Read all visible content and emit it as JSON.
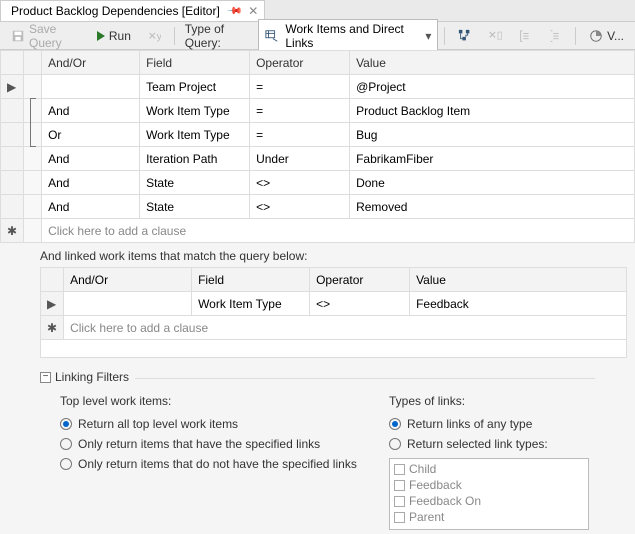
{
  "tab": {
    "title": "Product Backlog Dependencies [Editor]"
  },
  "toolbar": {
    "save_label": "Save Query",
    "run_label": "Run",
    "type_label": "Type of Query:",
    "type_value": "Work Items and Direct Links",
    "view_label": "V..."
  },
  "grid": {
    "headers": {
      "andor": "And/Or",
      "field": "Field",
      "operator": "Operator",
      "value": "Value"
    },
    "rows": [
      {
        "gutter": "▶",
        "group": "",
        "andor": "",
        "field": "Team Project",
        "operator": "=",
        "value": "@Project"
      },
      {
        "gutter": "",
        "group": "[",
        "andor": "And",
        "field": "Work Item Type",
        "operator": "=",
        "value": "Product Backlog Item"
      },
      {
        "gutter": "",
        "group": "]",
        "andor": "Or",
        "field": "Work Item Type",
        "operator": "=",
        "value": "Bug"
      },
      {
        "gutter": "",
        "group": "",
        "andor": "And",
        "field": "Iteration Path",
        "operator": "Under",
        "value": "FabrikamFiber"
      },
      {
        "gutter": "",
        "group": "",
        "andor": "And",
        "field": "State",
        "operator": "<>",
        "value": "Done"
      },
      {
        "gutter": "",
        "group": "",
        "andor": "And",
        "field": "State",
        "operator": "<>",
        "value": "Removed"
      }
    ],
    "new_row_gutter": "✱",
    "new_row_placeholder": "Click here to add a clause"
  },
  "linked": {
    "intro": "And linked work items that match the query below:",
    "headers": {
      "andor": "And/Or",
      "field": "Field",
      "operator": "Operator",
      "value": "Value"
    },
    "rows": [
      {
        "gutter": "▶",
        "andor": "",
        "field": "Work Item Type",
        "operator": "<>",
        "value": "Feedback"
      }
    ],
    "new_row_gutter": "✱",
    "new_row_placeholder": "Click here to add a clause"
  },
  "filters": {
    "legend": "Linking Filters",
    "top_label": "Top level work items:",
    "top_options": [
      {
        "label": "Return all top level work items",
        "checked": true
      },
      {
        "label": "Only return items that have the specified links",
        "checked": false
      },
      {
        "label": "Only return items that do not have the specified links",
        "checked": false
      }
    ],
    "types_label": "Types of links:",
    "types_options": [
      {
        "label": "Return links of any type",
        "checked": true
      },
      {
        "label": "Return selected link types:",
        "checked": false
      }
    ],
    "link_types": [
      "Child",
      "Feedback",
      "Feedback On",
      "Parent"
    ]
  }
}
